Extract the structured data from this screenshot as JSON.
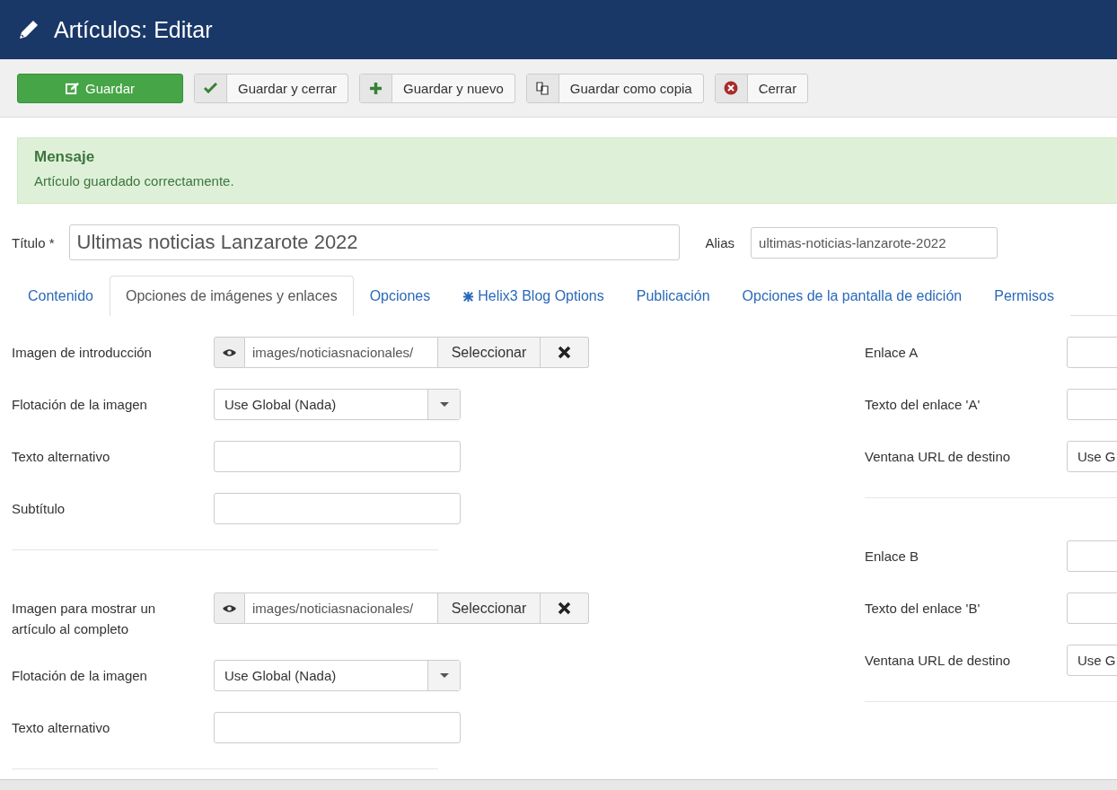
{
  "header": {
    "title": "Artículos: Editar"
  },
  "toolbar": [
    {
      "kind": "primary",
      "label": "Guardar"
    },
    {
      "kind": "split",
      "label": "Guardar y cerrar"
    },
    {
      "kind": "split",
      "label": "Guardar y nuevo"
    },
    {
      "kind": "split",
      "label": "Guardar como copia"
    },
    {
      "kind": "split",
      "label": "Cerrar"
    }
  ],
  "message": {
    "heading": "Mensaje",
    "text": "Artículo guardado correctamente."
  },
  "title_field": {
    "label": "Título *",
    "value": "Ultimas noticias Lanzarote 2022"
  },
  "alias_field": {
    "label": "Alias",
    "value": "ultimas-noticias-lanzarote-2022"
  },
  "tabs": [
    {
      "label": "Contenido",
      "selected": false
    },
    {
      "label": "Opciones de imágenes y enlaces",
      "selected": true
    },
    {
      "label": "Opciones",
      "selected": false
    },
    {
      "label": "Helix3 Blog Options",
      "selected": false
    },
    {
      "label": "Publicación",
      "selected": false
    },
    {
      "label": "Opciones de la pantalla de edición",
      "selected": false
    },
    {
      "label": "Permisos",
      "selected": false
    }
  ],
  "left_groups": [
    [
      {
        "kind": "media",
        "label": "Imagen de introducción",
        "value": "images/noticiasnacionales/",
        "button": "Seleccionar"
      },
      {
        "kind": "select",
        "label": "Flotación de la imagen",
        "value": "Use Global (Nada)"
      },
      {
        "kind": "text",
        "label": "Texto alternativo"
      },
      {
        "kind": "text",
        "label": "Subtítulo"
      }
    ],
    [
      {
        "kind": "media",
        "label": "Imagen para mostrar un artículo al completo",
        "value": "images/noticiasnacionales/",
        "button": "Seleccionar"
      },
      {
        "kind": "select",
        "label": "Flotación de la imagen",
        "value": "Use Global (Nada)"
      },
      {
        "kind": "text",
        "label": "Texto alternativo"
      }
    ]
  ],
  "right_groups": [
    [
      {
        "kind": "text",
        "label": "Enlace A"
      },
      {
        "kind": "text",
        "label": "Texto del enlace 'A'"
      },
      {
        "kind": "select",
        "label": "Ventana URL de destino",
        "value": "Use G"
      }
    ],
    [
      {
        "kind": "text",
        "label": "Enlace B"
      },
      {
        "kind": "text",
        "label": "Texto del enlace 'B'"
      },
      {
        "kind": "select",
        "label": "Ventana URL de destino",
        "value": "Use G"
      }
    ]
  ]
}
